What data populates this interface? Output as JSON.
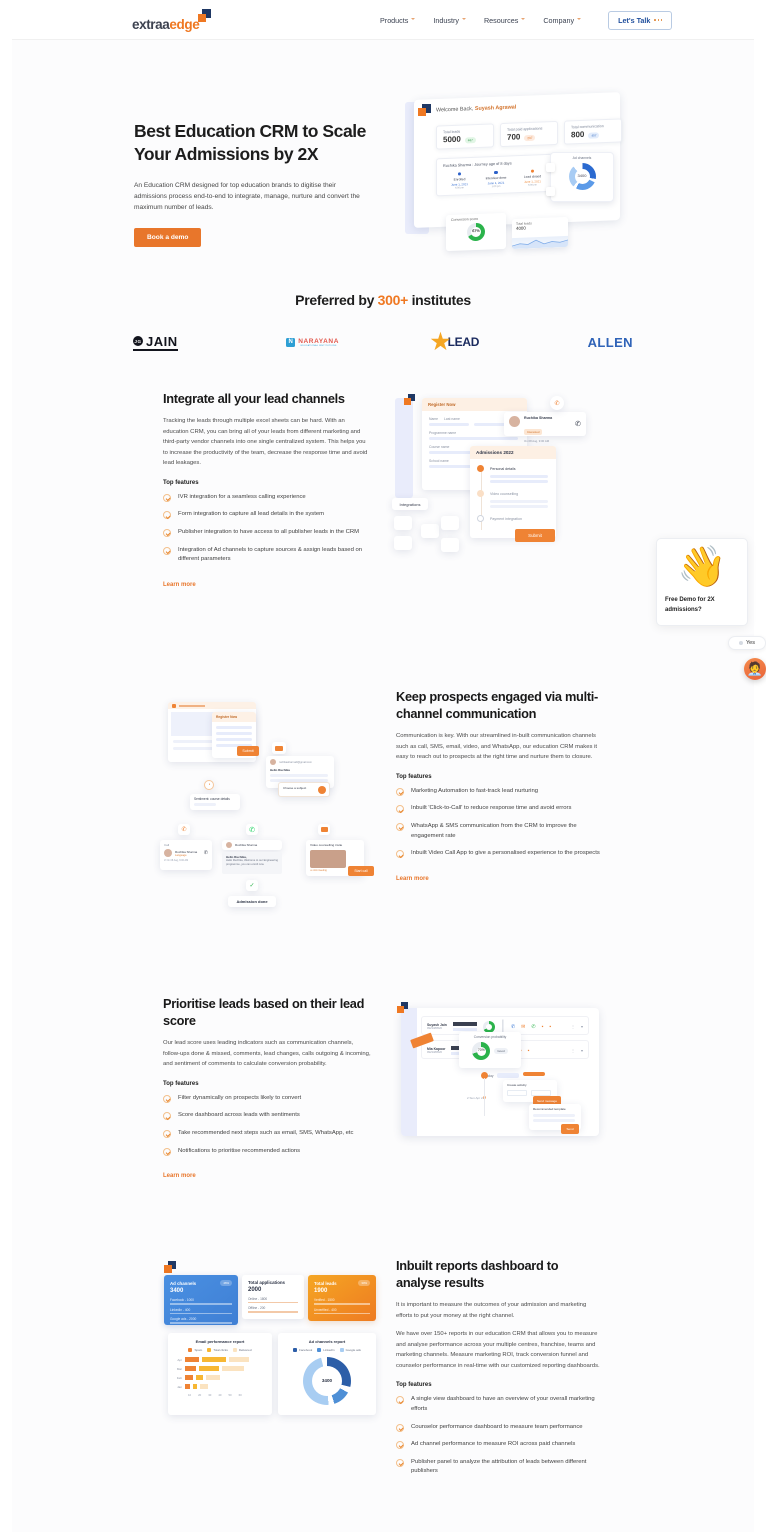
{
  "header": {
    "logo": {
      "part1": "extraa",
      "part2": "edge"
    },
    "nav": [
      {
        "label": "Products"
      },
      {
        "label": "Industry"
      },
      {
        "label": "Resources"
      },
      {
        "label": "Company"
      }
    ],
    "cta": "Let's Talk"
  },
  "hero": {
    "title": "Best Education CRM to Scale Your Admissions by 2X",
    "subtitle": "An Education CRM designed for top education brands to digitise their admissions process end-to-end to integrate, manage, nurture and convert the maximum number of leads.",
    "button": "Book a demo",
    "mock": {
      "welcome_prefix": "Welcome Back, ",
      "welcome_name": "Suyash Agrawal",
      "cards": [
        {
          "label": "Total leads",
          "value": "5000",
          "badge": "467"
        },
        {
          "label": "Total paid applications",
          "value": "700",
          "badge": "237"
        },
        {
          "label": "Total communication",
          "value": "800",
          "badge": "407"
        }
      ],
      "journey_title": "Ruchika Sharma : Journey age of 8 days",
      "journey": [
        {
          "name": "Enrolled",
          "date": "June 1, 2021",
          "time": "5:00 pm"
        },
        {
          "name": "Interview done",
          "date": "June 1, 2021",
          "time": "1:00 pm"
        },
        {
          "name": "Lead closed",
          "date": "June 1, 2021",
          "time": "6:00 pm"
        }
      ],
      "journey_gaps": [
        "2 days",
        "3 days"
      ],
      "ad_channels_title": "Ad channels",
      "ad_channels_value": "3400",
      "conversion_title": "Conversion score",
      "conversion_value": "67%",
      "conversion_tag": "Strong",
      "total_leads_title": "Total leads",
      "total_leads_value": "4000"
    }
  },
  "preferred": {
    "title_before": "Preferred by ",
    "title_highlight": "300+",
    "title_after": " institutes",
    "logos": [
      {
        "name": "JAIN",
        "mark": "JG"
      },
      {
        "name": "NARAYANA",
        "mark": "N",
        "sub": "EDUCATIONAL INSTITUTIONS"
      },
      {
        "name": "LEAD"
      },
      {
        "name": "ALLEN"
      }
    ]
  },
  "features": [
    {
      "id": "lead-channels",
      "title": "Integrate all your lead channels",
      "paragraphs": [
        "Tracking the leads through multiple excel sheets can be hard. With an education CRM, you can bring all of your leads from different marketing and third-party vendor channels into one single centralized system. This helps you to increase the productivity of the team, decrease the response time and avoid lead leakages."
      ],
      "top_features_label": "Top features",
      "items": [
        "IVR integration for a seamless calling experience",
        "Form integration to capture all lead details in the system",
        "Publisher integration to have access to all publisher leads in the CRM",
        "Integration of Ad channels to capture sources & assign leads based on different parameters"
      ],
      "learn_more": "Learn more",
      "mock": {
        "form_title": "Register Now",
        "fields": [
          "Name",
          "Last name",
          "Programme name",
          "Course name",
          "School name"
        ],
        "submit": "Submit",
        "lead_name": "Ruchika Sharma",
        "lead_badge": "Interested",
        "lead_meta": "On 08 Aug, 9:00 AM",
        "admissions_title": "Admissions 2022",
        "steps": [
          "Personal details",
          "Video counselling",
          "Payment integration"
        ],
        "integrations_label": "Integrations"
      }
    },
    {
      "id": "multi-channel",
      "title": "Keep prospects engaged via multi-channel communication",
      "paragraphs": [
        "Communication is key. With our streamlined in-built communication channels such as call, SMS, email, video, and WhatsApp, our education CRM makes it easy to reach out to prospects at the right time and nurture them to closure."
      ],
      "top_features_label": "Top features",
      "items": [
        "Marketing Automation to fast-track lead nurturing",
        "Inbuilt 'Click-to-Call' to reduce response time and avoid errors",
        "WhatsApp & SMS communication from the CRM to improve the engagement rate",
        "Inbuilt Video Call App to give a personalised experience to the prospects"
      ],
      "learn_more": "Learn more",
      "mock": {
        "form_title": "Register Now",
        "submit": "Submit",
        "email_subject": "Hello Ruchika",
        "course_card": "Choose a subject",
        "sentiment_node": "Sentiment: course details",
        "call_label": "Call",
        "lead_name": "Ruchika Sharma",
        "lead_badge": "Language",
        "whatsapp_name": "Ruchika Sharma",
        "whatsapp_msg": "Hello Ruchika, Welcome to our Engineering programme, you can enroll now.",
        "video_title": "Video counselling invite",
        "video_btn": "Start call",
        "end_node": "Admission done"
      }
    },
    {
      "id": "lead-score",
      "title": "Prioritise leads based on their lead score",
      "paragraphs": [
        "Our lead score uses leading indicators such as communication channels, follow-ups done & missed, comments, lead changes, calls outgoing & incoming, and sentiment of comments to calculate conversion probability."
      ],
      "top_features_label": "Top features",
      "items": [
        "Filter dynamically on prospects likely to convert",
        "Score dashboard across leads with sentiments",
        "Take recommended next steps such as email, SMS, WhatsApp, etc",
        "Notifications to prioritise recommended actions"
      ],
      "learn_more": "Learn more",
      "mock": {
        "row1_name": "Suyash Jain",
        "row1_id": "9923489520",
        "row1_score": "67%",
        "row2_name": "Mia Kapoor",
        "row2_id": "9923489520",
        "tooltip_title": "Conversion probability",
        "tooltip_value": "70%",
        "tooltip_tag": "Good",
        "timeline_today": "Today",
        "timeline_prev": "2 Sun Apr 21",
        "activity_title": "Create activity",
        "activity_btn": "Send message",
        "template_title": "Recommended template",
        "template_btn": "Send"
      }
    },
    {
      "id": "reports",
      "title": "Inbuilt reports dashboard to analyse results",
      "paragraphs": [
        "It is important to measure the outcomes of your admission and marketing efforts to put your money at the right channel.",
        "We have over 150+ reports in our education CRM that allows you to measure and analyse performance across your multiple centres, franchise, teams and marketing channels. Measure marketing ROI, track conversion funnel and counselor performance in real-time with our customized reporting dashboards."
      ],
      "top_features_label": "Top features",
      "items": [
        "A single view dashboard to have an overview of your overall marketing efforts",
        "Counselor performance dashboard to measure team performance",
        "Ad channel performance to measure ROI across paid channels",
        "Publisher panel to analyze the attribution of leads between different publishers"
      ],
      "learn_more": "Learn more",
      "mock": {
        "card_ad": {
          "title": "Ad channels",
          "value": "3400",
          "badge": "46%",
          "rows": [
            [
              "Facebook",
              "1000"
            ],
            [
              "LinkedIn",
              "400"
            ],
            [
              "Google ads",
              "2000"
            ]
          ]
        },
        "card_app": {
          "title": "Total applications",
          "value": "2000",
          "rows": [
            [
              "Online",
              "1800"
            ],
            [
              "Offline",
              "200"
            ]
          ]
        },
        "card_leads": {
          "title": "Total leads",
          "value": "1900",
          "badge": "30%",
          "rows": [
            [
              "Verified",
              "1500"
            ],
            [
              "Unverified",
              "400"
            ]
          ]
        },
        "email_report_title": "Email performance report",
        "email_legend": [
          "Spam",
          "Total clicks",
          "Delivered"
        ],
        "email_categories": [
          "Apr",
          "Mar",
          "Feb",
          "Jan"
        ],
        "email_axis": [
          "10",
          "20",
          "30",
          "40",
          "50",
          "60"
        ],
        "ad_report_title": "Ad channels report",
        "ad_legend": [
          "Facebook",
          "LinkedIn",
          "Google ads"
        ],
        "ad_center_value": "3400"
      }
    }
  ],
  "chat": {
    "emoji": "👋",
    "message": "Free Demo for 2X admissions?",
    "yes_label": "Yes",
    "avatar": "🧑‍💼"
  },
  "chart_data": [
    {
      "type": "bar",
      "title": "Email performance report",
      "categories": [
        "Apr",
        "Mar",
        "Feb",
        "Jan"
      ],
      "series": [
        {
          "name": "Spam",
          "values": [
            8,
            6,
            5,
            4
          ]
        },
        {
          "name": "Total clicks",
          "values": [
            22,
            18,
            7,
            3
          ]
        },
        {
          "name": "Delivered",
          "values": [
            25,
            23,
            12,
            5
          ]
        }
      ],
      "xlabel": "",
      "ylabel": "",
      "xlim": [
        0,
        60
      ],
      "grid": false,
      "legend": "top"
    },
    {
      "type": "pie",
      "title": "Ad channels report",
      "labels": [
        "Facebook",
        "LinkedIn",
        "Google ads"
      ],
      "values": [
        1000,
        400,
        2000
      ],
      "center_label": "3400",
      "legend": "top"
    },
    {
      "type": "pie",
      "title": "Ad channels",
      "labels": [
        "Facebook",
        "LinkedIn",
        "Google ads"
      ],
      "values": [
        1000,
        400,
        2000
      ],
      "center_label": "3400",
      "legend": "none"
    },
    {
      "type": "pie",
      "title": "Conversion score",
      "labels": [
        "Converted",
        "Remaining"
      ],
      "values": [
        67,
        33
      ],
      "center_label": "67%",
      "legend": "none"
    }
  ]
}
